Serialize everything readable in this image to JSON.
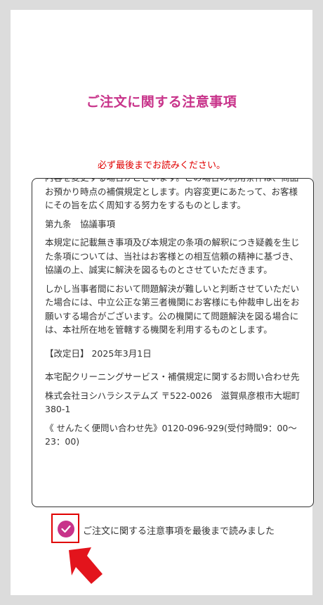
{
  "page": {
    "title": "ご注文に関する注意事項",
    "notice": "必ず最後までお読みください。"
  },
  "terms": {
    "paragraphs": [
      "内容を変更する場合がございます。この場合の利用条件は、商品お預かり時点の補償規定とします。内容変更にあたって、お客様にその旨を広く周知する努力をするものとします。",
      "第九条　協議事項",
      "本規定に記載無き事項及び本規定の条項の解釈につき疑義を生じた条項については、当社はお客様との相互信頼の精神に基づき、協議の上、誠実に解決を図るものとさせていただきます。",
      "しかし当事者間において問題解決が難しいと判断させていただいた場合には、中立公正な第三者機関にお客様にも仲裁申し出をお願いする場合がございます。公の機関にて問題解決を図る場合には、本社所在地を管轄する機関を利用するものとします。",
      "【改定日】 2025年3月1日",
      "本宅配クリーニングサービス・補償規定に関するお問い合わせ先",
      "株式会社ヨシハラシステムズ 〒522-0026　滋賀県彦根市大堀町380-1",
      "《 せんたく便問い合わせ先》0120-096-929(受付時間9：00〜23：00)"
    ]
  },
  "confirm": {
    "label": "ご注文に関する注意事項を最後まで読みました",
    "checked": true
  },
  "colors": {
    "accent": "#c8338a",
    "warning": "#e00000",
    "background": "#dcdcdc"
  },
  "icons": {
    "check": "check-icon",
    "arrow": "pointer-arrow-icon"
  }
}
